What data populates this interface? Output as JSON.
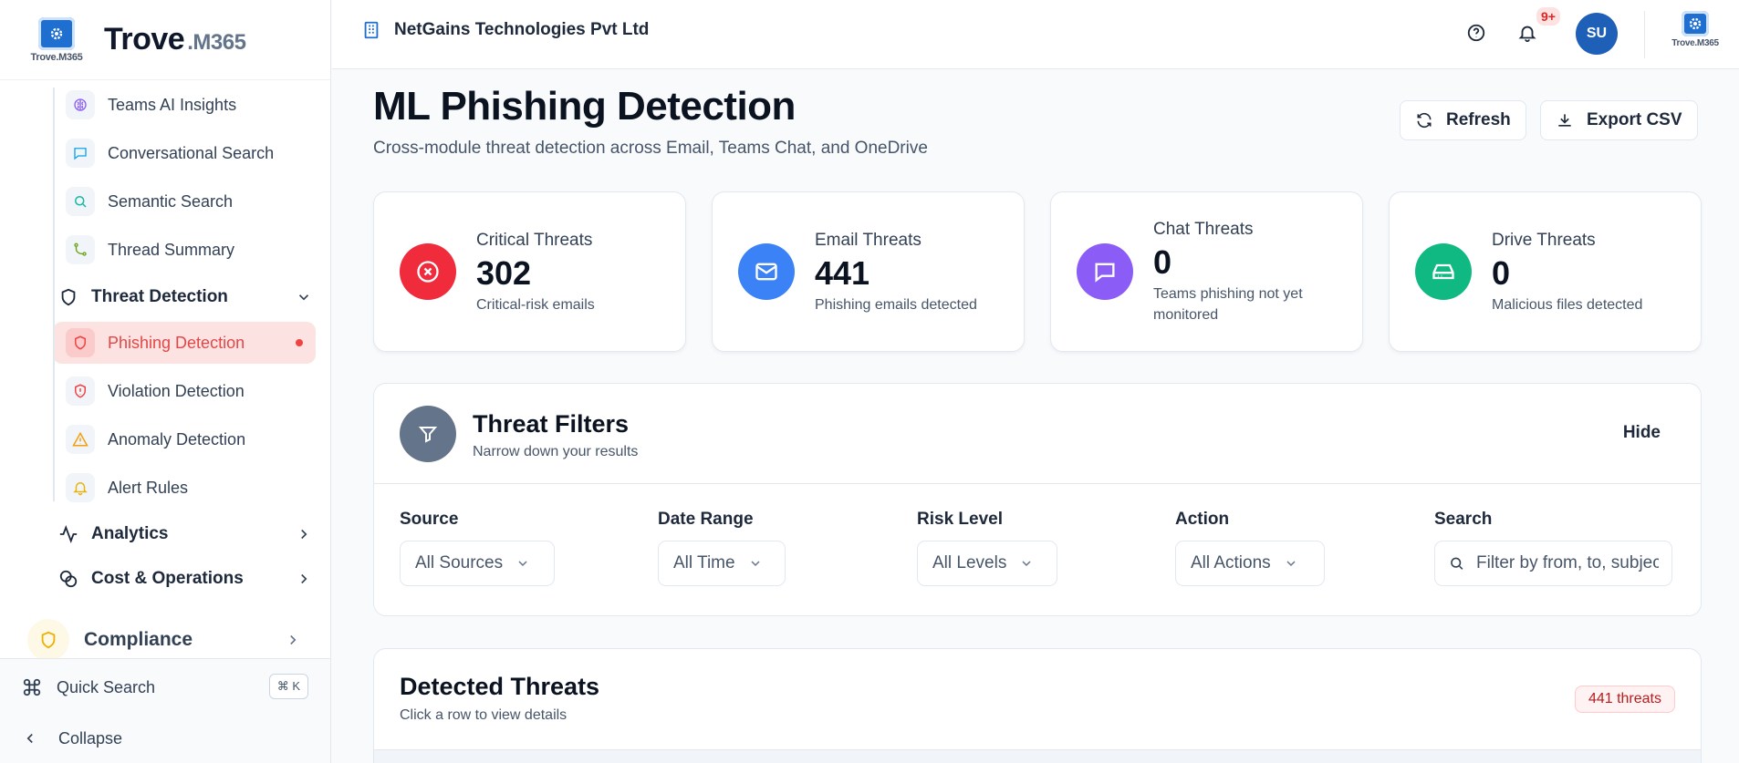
{
  "brand": {
    "logo_caption": "Trove.M365",
    "name": "Trove",
    "suffix": ".M365"
  },
  "sidebar": {
    "ai_items": [
      {
        "label": "Teams AI Insights",
        "icon": "brain-icon",
        "color": "#8b5cf6"
      },
      {
        "label": "Conversational Search",
        "icon": "chat-icon",
        "color": "#0ea5e9"
      },
      {
        "label": "Semantic Search",
        "icon": "search-icon",
        "color": "#14b8a6"
      },
      {
        "label": "Thread Summary",
        "icon": "git-branch-icon",
        "color": "#65a30d"
      }
    ],
    "threat_group": {
      "label": "Threat Detection",
      "expanded": true
    },
    "threat_items": [
      {
        "label": "Phishing Detection",
        "icon": "shield-icon",
        "color": "#ef4444",
        "active": true
      },
      {
        "label": "Violation Detection",
        "icon": "shield-alert-icon",
        "color": "#ef4444"
      },
      {
        "label": "Anomaly Detection",
        "icon": "warning-icon",
        "color": "#f59e0b"
      },
      {
        "label": "Alert Rules",
        "icon": "bell-icon",
        "color": "#eab308"
      }
    ],
    "analytics_label": "Analytics",
    "cost_label": "Cost & Operations",
    "compliance_label": "Compliance",
    "quick_search_label": "Quick Search",
    "quick_search_shortcut": "⌘ K",
    "collapse_label": "Collapse"
  },
  "header": {
    "org_name": "NetGains Technologies Pvt Ltd",
    "notifications_badge": "9+",
    "avatar_initials": "SU",
    "logo_caption": "Trove.M365"
  },
  "page": {
    "title": "ML Phishing Detection",
    "subtitle": "Cross-module threat detection across Email, Teams Chat, and OneDrive",
    "refresh_label": "Refresh",
    "export_label": "Export CSV"
  },
  "stats": [
    {
      "title": "Critical Threats",
      "value": "302",
      "desc": "Critical-risk emails",
      "color": "#ef2b3c",
      "icon": "x-circle-icon"
    },
    {
      "title": "Email Threats",
      "value": "441",
      "desc": "Phishing emails detected",
      "color": "#3b82f6",
      "icon": "mail-icon"
    },
    {
      "title": "Chat Threats",
      "value": "0",
      "desc": "Teams phishing not yet monitored",
      "color": "#8b5cf6",
      "icon": "message-icon"
    },
    {
      "title": "Drive Threats",
      "value": "0",
      "desc": "Malicious files detected",
      "color": "#10b981",
      "icon": "hard-drive-icon"
    }
  ],
  "filters": {
    "title": "Threat Filters",
    "subtitle": "Narrow down your results",
    "hide_label": "Hide",
    "source": {
      "label": "Source",
      "value": "All Sources"
    },
    "date_range": {
      "label": "Date Range",
      "value": "All Time"
    },
    "risk_level": {
      "label": "Risk Level",
      "value": "All Levels"
    },
    "action": {
      "label": "Action",
      "value": "All Actions"
    },
    "search": {
      "label": "Search",
      "placeholder": "Filter by from, to, subject..."
    }
  },
  "detected": {
    "title": "Detected Threats",
    "subtitle": "Click a row to view details",
    "badge": "441 threats"
  }
}
